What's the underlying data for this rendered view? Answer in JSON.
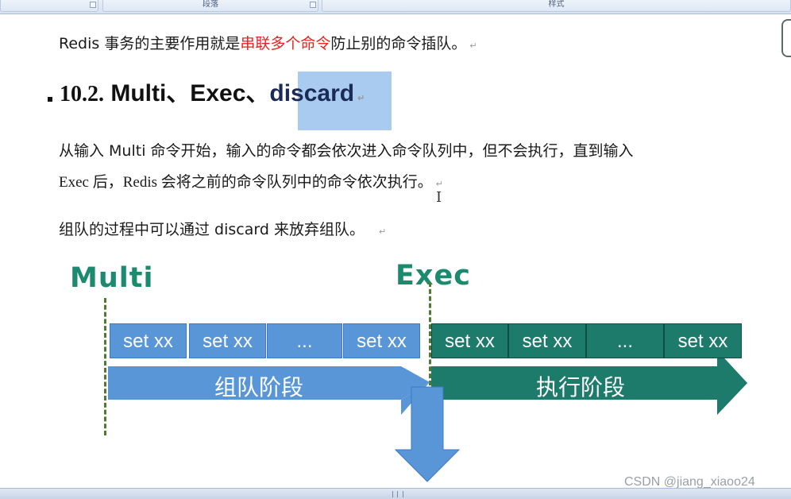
{
  "ribbon": {
    "groups": [
      "段落",
      "样式"
    ]
  },
  "document": {
    "line1": {
      "pre": "Redis 事务的主要作用就是",
      "highlight": "串联多个命令",
      "post": "防止别的命令插队。"
    },
    "heading": {
      "number": "10.2.",
      "text": " Multi、Exec、",
      "selected": "discard"
    },
    "para1": {
      "line1": "从输入 Multi 命令开始，输入的命令都会依次进入命令队列中，但不会执行，直到输入",
      "line2": "Exec 后，Redis 会将之前的命令队列中的命令依次执行。"
    },
    "para2": "组队的过程中可以通过 discard 来放弃组队。",
    "pilcrow": "↵"
  },
  "diagram": {
    "multi_label": "Multi",
    "exec_label": "Exec",
    "queue_boxes": [
      "set xx",
      "set xx",
      "...",
      "set xx"
    ],
    "exec_boxes": [
      "set xx",
      "set xx",
      "...",
      "set xx"
    ],
    "queue_stage": "组队阶段",
    "exec_stage": "执行阶段",
    "colors": {
      "queue_blue": "#5896d8",
      "exec_green": "#1c7b6a",
      "label_green": "#1c8a6e",
      "highlight_red": "#e8231f"
    }
  },
  "watermark": "CSDN @jiang_xiaoo24",
  "icons": [
    "text-cursor-icon",
    "dialog-launcher-icon",
    "resize-grip-icon"
  ]
}
